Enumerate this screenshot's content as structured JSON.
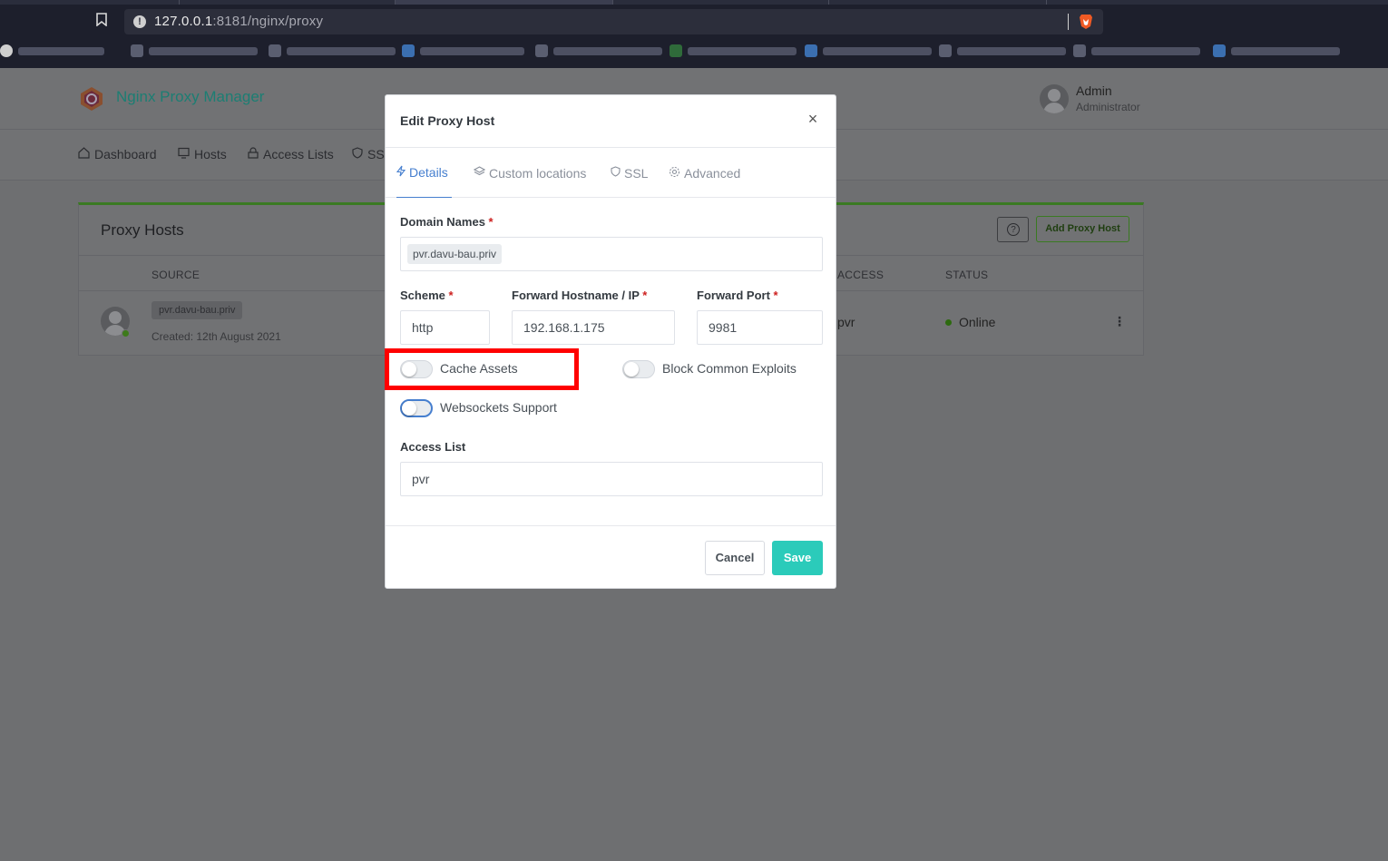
{
  "browser": {
    "url_host": "127.0.0.1",
    "url_rest": ":8181/nginx/proxy"
  },
  "app": {
    "title": "Nginx Proxy Manager",
    "user_name": "Admin",
    "user_role": "Administrator"
  },
  "nav": {
    "items": [
      {
        "label": "Dashboard",
        "icon": "home-icon"
      },
      {
        "label": "Hosts",
        "icon": "monitor-icon"
      },
      {
        "label": "Access Lists",
        "icon": "lock-icon"
      },
      {
        "label": "SSL",
        "icon": "shield-icon"
      }
    ]
  },
  "proxy_hosts": {
    "title": "Proxy Hosts",
    "add_button": "Add Proxy Host",
    "help_symbol": "?",
    "columns": [
      "SOURCE",
      "ACCESS",
      "STATUS"
    ],
    "rows": [
      {
        "source": "pvr.davu-bau.priv",
        "created": "Created: 12th August 2021",
        "access": "pvr",
        "status": "Online"
      }
    ]
  },
  "modal": {
    "title": "Edit Proxy Host",
    "close_symbol": "×",
    "tabs": [
      {
        "label": "Details",
        "icon": "bolt-icon",
        "active": true
      },
      {
        "label": "Custom locations",
        "icon": "layers-icon",
        "active": false
      },
      {
        "label": "SSL",
        "icon": "shield-icon",
        "active": false
      },
      {
        "label": "Advanced",
        "icon": "gear-icon",
        "active": false
      }
    ],
    "domain_names_label": "Domain Names",
    "domain_names": [
      "pvr.davu-bau.priv"
    ],
    "scheme_label": "Scheme",
    "scheme_value": "http",
    "forward_host_label": "Forward Hostname / IP",
    "forward_host_value": "192.168.1.175",
    "forward_port_label": "Forward Port",
    "forward_port_value": "9981",
    "required_mark": "*",
    "toggles": {
      "cache_assets": {
        "label": "Cache Assets",
        "on": false
      },
      "block_exploits": {
        "label": "Block Common Exploits",
        "on": false
      },
      "websockets": {
        "label": "Websockets Support",
        "on": false
      }
    },
    "access_list_label": "Access List",
    "access_list_value": "pvr",
    "cancel_label": "Cancel",
    "save_label": "Save"
  },
  "colors": {
    "accent": "#467fcf",
    "save": "#2bcbba",
    "highlight": "#ff0000",
    "required": "#cd201f"
  }
}
